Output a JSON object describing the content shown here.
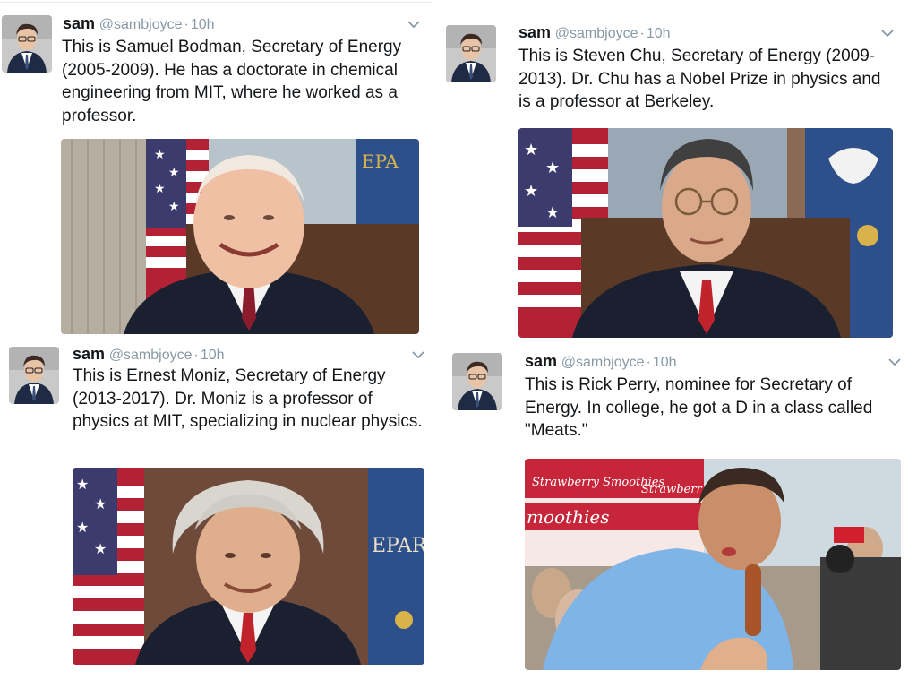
{
  "tweets": [
    {
      "name": "sam",
      "handle": "@sambjoyce",
      "separator": "·",
      "time": "10h",
      "text": "This is Samuel Bodman, Secretary of Energy (2005-2009). He has a doctorate in chemical engineering from MIT, where he worked as a professor."
    },
    {
      "name": "sam",
      "handle": "@sambjoyce",
      "separator": "·",
      "time": "10h",
      "text": "This is Steven Chu, Secretary of Energy (2009-2013). Dr. Chu has a Nobel Prize in physics and is a professor at Berkeley."
    },
    {
      "name": "sam",
      "handle": "@sambjoyce",
      "separator": "·",
      "time": "10h",
      "text": "This is Ernest Moniz, Secretary of Energy (2013-2017). Dr. Moniz is a professor of physics at MIT, specializing in nuclear physics."
    },
    {
      "name": "sam",
      "handle": "@sambjoyce",
      "separator": "·",
      "time": "10h",
      "text": "This is Rick Perry, nominee for Secretary of Energy. In college, he got a D in a class called \"Meats.\""
    }
  ],
  "photo_text": {
    "bodman_seal": "EPA",
    "moniz_seal": "EPAR",
    "perry_sign_1": "Strawberry Smoothies",
    "perry_sign_2": "moothies",
    "perry_sign_3": "Strawberr"
  },
  "colors": {
    "text": "#14171a",
    "muted": "#8899a6"
  },
  "icons": {
    "caret": "chevron-down-icon",
    "avatar": "avatar"
  }
}
